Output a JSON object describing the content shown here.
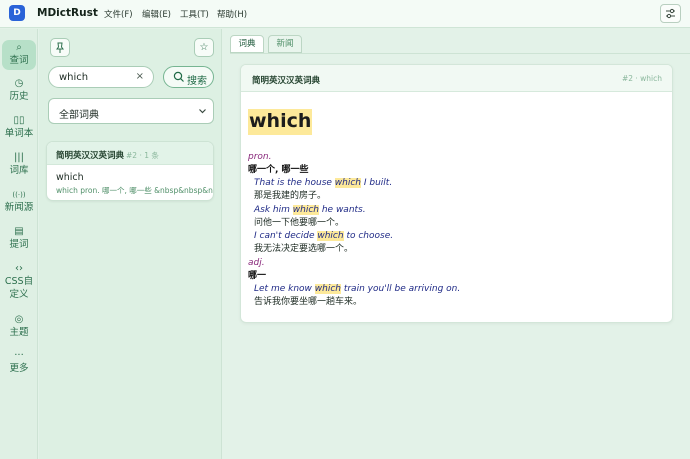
{
  "app": {
    "logo_letter": "D",
    "name": "MDictRust"
  },
  "menu": [
    "文件(F)",
    "编辑(E)",
    "工具(T)",
    "帮助(H)"
  ],
  "rail": [
    {
      "icon": "⌕",
      "label": "查词",
      "active": true
    },
    {
      "icon": "◷",
      "label": "历史"
    },
    {
      "icon": "▯▯",
      "label": "单词本"
    },
    {
      "icon": "|||",
      "label": "词库"
    },
    {
      "icon": "((·))",
      "label": "新闻源"
    },
    {
      "icon": "▤",
      "label": "提词"
    },
    {
      "icon": "‹›",
      "label": "CSS自定义"
    },
    {
      "icon": "◎",
      "label": "主题"
    },
    {
      "icon": "···",
      "label": "更多"
    }
  ],
  "search": {
    "value": "which",
    "clear_glyph": "×",
    "button_label": "搜索",
    "dict_selected": "全部词典"
  },
  "results": [
    {
      "dict_name": "简明英汉汉英词典",
      "meta": "#2 · 1 条",
      "word": "which",
      "snippet": "which pron. 哪一个, 哪一些 &nbsp&nbsp&n…"
    }
  ],
  "tabs": [
    {
      "label": "词典",
      "active": true
    },
    {
      "label": "新闻",
      "active": false
    }
  ],
  "entry": {
    "dict_name": "简明英汉汉英词典",
    "meta": "#2 · which",
    "headword": "which",
    "lines": [
      {
        "kind": "pos",
        "text": "pron."
      },
      {
        "kind": "gloss",
        "text": "哪一个, 哪一些"
      },
      {
        "kind": "ex",
        "before": "That is the house ",
        "hl": "which",
        "after": " I built."
      },
      {
        "kind": "tr",
        "text": "那是我建的房子。"
      },
      {
        "kind": "ex",
        "before": "Ask him ",
        "hl": "which",
        "after": " he wants."
      },
      {
        "kind": "tr",
        "text": "问他一下他要哪一个。"
      },
      {
        "kind": "ex",
        "before": "I can't decide ",
        "hl": "which",
        "after": " to choose."
      },
      {
        "kind": "tr",
        "text": "我无法决定要选哪一个。"
      },
      {
        "kind": "pos",
        "text": "adj."
      },
      {
        "kind": "gloss",
        "text": "哪一"
      },
      {
        "kind": "ex",
        "before": "Let me know ",
        "hl": "which",
        "after": " train you'll be arriving on."
      },
      {
        "kind": "tr",
        "text": "告诉我你要坐哪一趟车来。"
      }
    ]
  },
  "colors": {
    "accent": "#2c6f4d",
    "highlight": "#fde99a",
    "pos": "#8a2a7c",
    "example": "#1f2a86",
    "logo": "#2a63d8"
  }
}
